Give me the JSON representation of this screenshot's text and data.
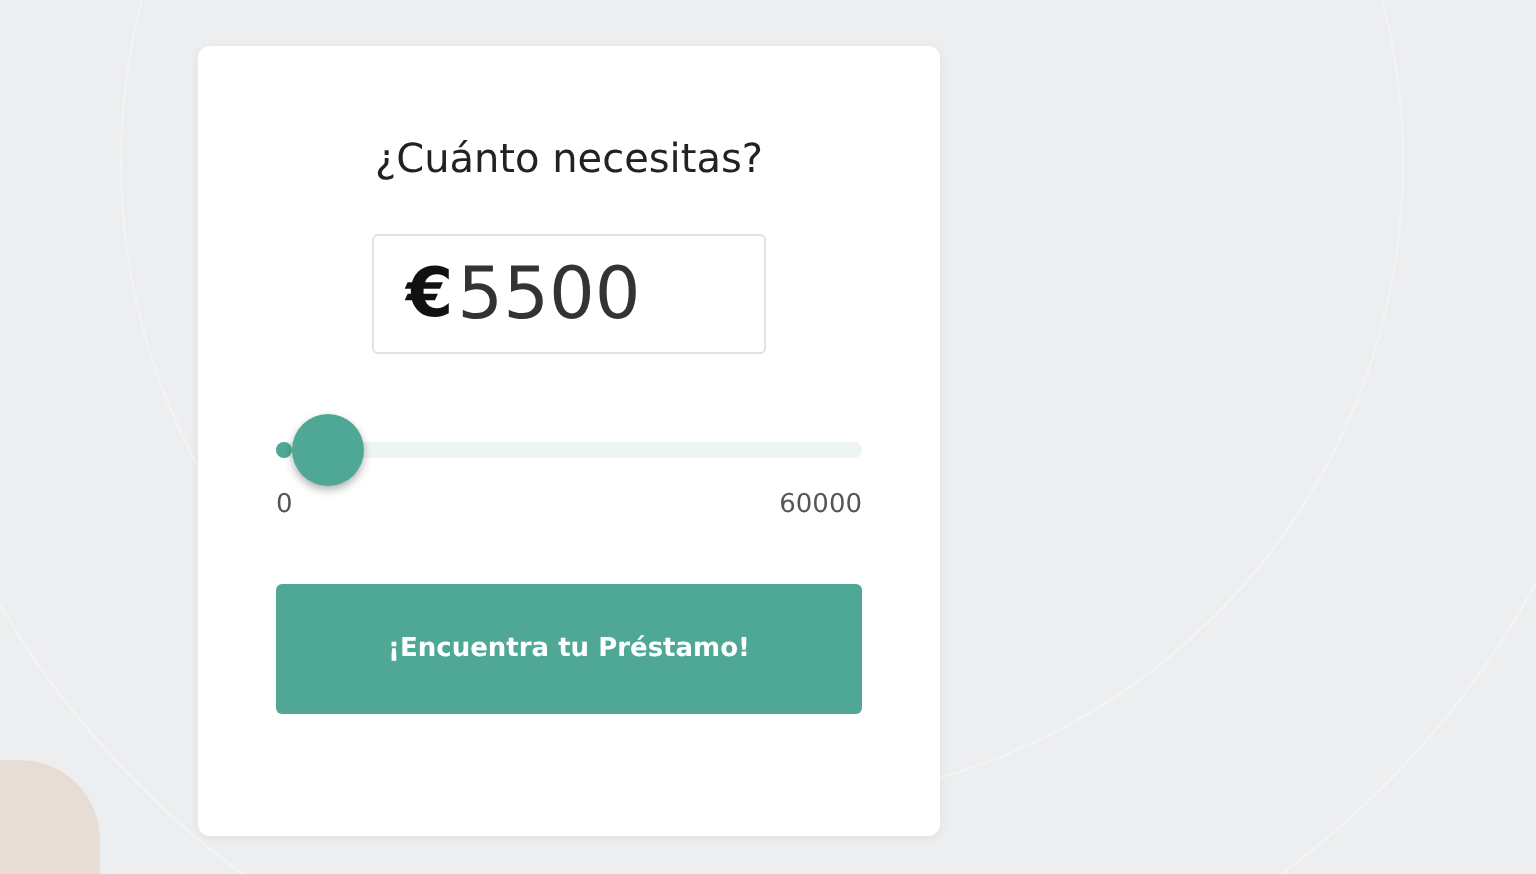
{
  "card": {
    "title": "¿Cuánto necesitas?",
    "amount": {
      "currency": "€",
      "value": "5500"
    },
    "slider": {
      "level": 0.09,
      "min_label": "0",
      "max_label": "60000"
    },
    "button": "¡Encuentra tu Préstamo!"
  }
}
